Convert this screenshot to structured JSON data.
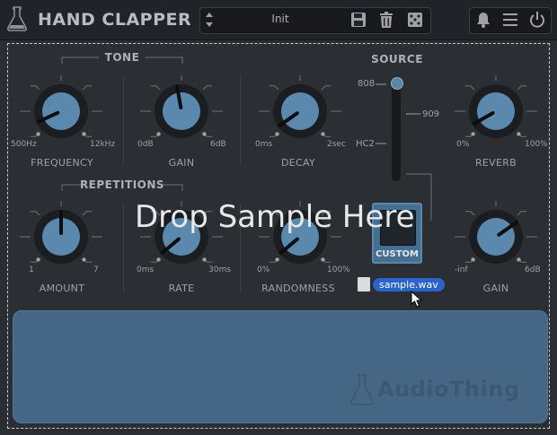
{
  "app": {
    "title": "HAND CLAPPER",
    "preset_name": "Init",
    "brand": "AudioThing"
  },
  "sections": {
    "tone": "TONE",
    "repetitions": "REPETITIONS",
    "source": "SOURCE"
  },
  "knobs": {
    "frequency": {
      "label": "FREQUENCY",
      "min": "500Hz",
      "max": "12kHz"
    },
    "gain_tone": {
      "label": "GAIN",
      "min": "0dB",
      "max": "6dB"
    },
    "decay": {
      "label": "DECAY",
      "min": "0ms",
      "max": "2sec"
    },
    "reverb": {
      "label": "REVERB",
      "min": "0%",
      "max": "100%"
    },
    "amount": {
      "label": "AMOUNT",
      "min": "1",
      "max": "7"
    },
    "rate": {
      "label": "RATE",
      "min": "0ms",
      "max": "30ms"
    },
    "randomness": {
      "label": "RANDOMNESS",
      "min": "0%",
      "max": "100%"
    },
    "gain_out": {
      "label": "GAIN",
      "min": "-inf",
      "max": "6dB"
    }
  },
  "source": {
    "option_808": "808",
    "option_909": "909",
    "option_hc2": "HC2",
    "custom_label": "CUSTOM"
  },
  "drop": {
    "overlay_text": "Drop Sample Here",
    "file_name": "sample.wav"
  },
  "colors": {
    "accent": "#456f91",
    "knob": "#5b88ad",
    "selection": "#2a63c9"
  }
}
